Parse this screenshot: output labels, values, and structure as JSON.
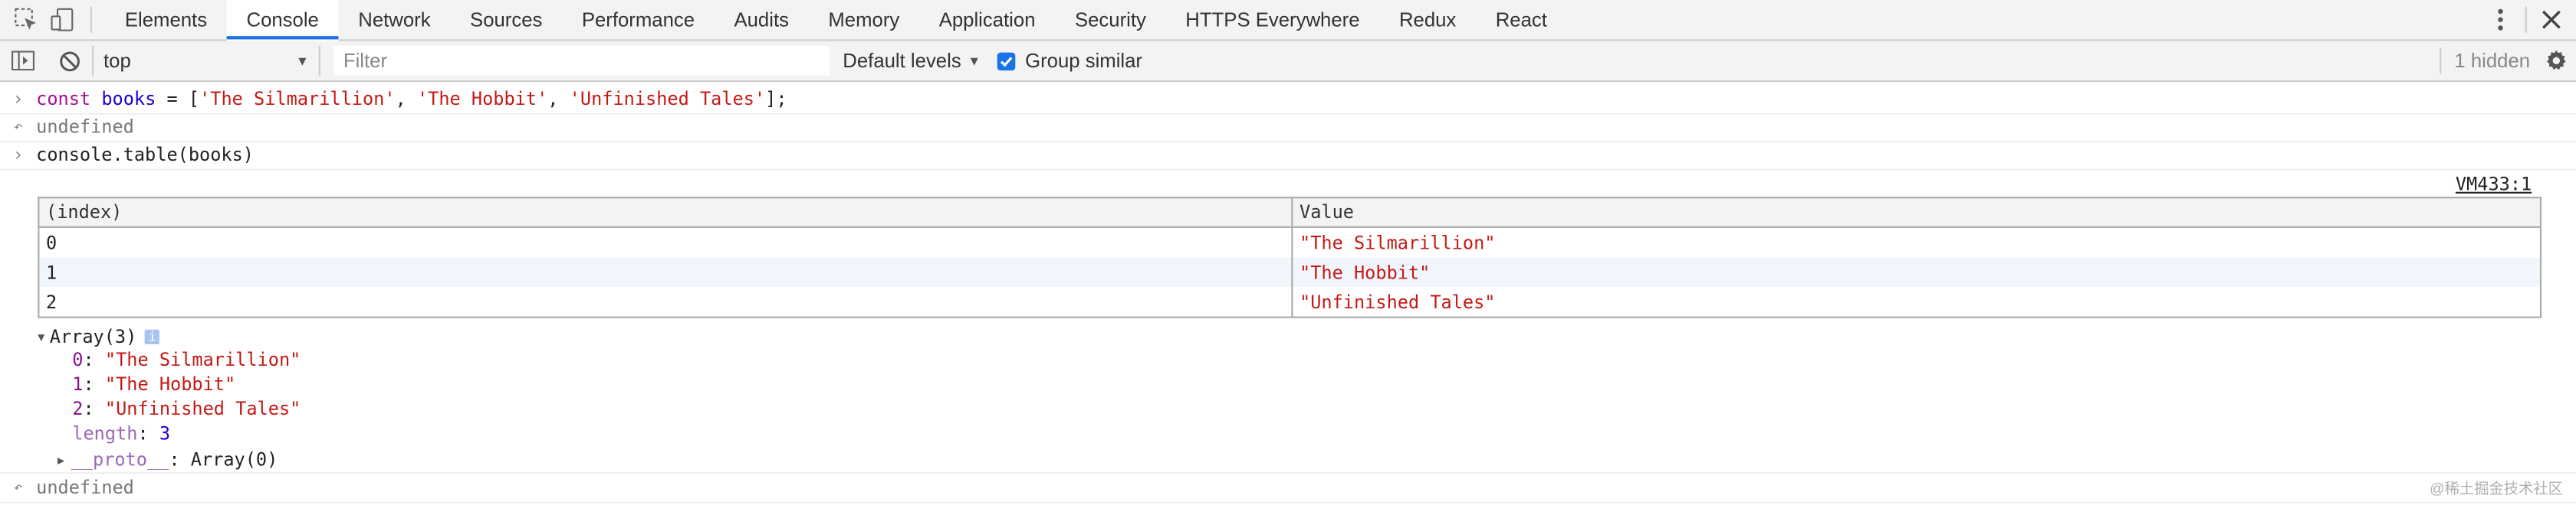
{
  "tabbar": {
    "tabs": [
      "Elements",
      "Console",
      "Network",
      "Sources",
      "Performance",
      "Audits",
      "Memory",
      "Application",
      "Security",
      "HTTPS Everywhere",
      "Redux",
      "React"
    ],
    "active_tab": "Console",
    "accent": "#1a73e8"
  },
  "toolbar": {
    "context_value": "top",
    "filter_placeholder": "Filter",
    "levels_label": "Default levels",
    "group_similar_label": "Group similar",
    "hidden_count": "1 hidden"
  },
  "console": {
    "input1": {
      "keyword": "const",
      "varname": "books",
      "eq": " = [",
      "s1": "'The Silmarillion'",
      "c1": ", ",
      "s2": "'The Hobbit'",
      "c2": ", ",
      "s3": "'Unfinished Tales'",
      "end": "];"
    },
    "result1": "undefined",
    "input2": "console.table(books)",
    "source_link": "VM433:1",
    "table": {
      "headers": [
        "(index)",
        "Value"
      ],
      "rows": [
        {
          "index": "0",
          "value": "\"The Silmarillion\""
        },
        {
          "index": "1",
          "value": "\"The Hobbit\""
        },
        {
          "index": "2",
          "value": "\"Unfinished Tales\""
        }
      ]
    },
    "array": {
      "label": "Array(3)",
      "info_badge": "i",
      "items": [
        {
          "key": "0",
          "value": "\"The Silmarillion\""
        },
        {
          "key": "1",
          "value": "\"The Hobbit\""
        },
        {
          "key": "2",
          "value": "\"Unfinished Tales\""
        }
      ],
      "length_key": "length",
      "length_value": "3",
      "proto_key": "__proto__",
      "proto_value": "Array(0)"
    },
    "result2": "undefined"
  },
  "watermark": "@稀土掘金技术社区"
}
